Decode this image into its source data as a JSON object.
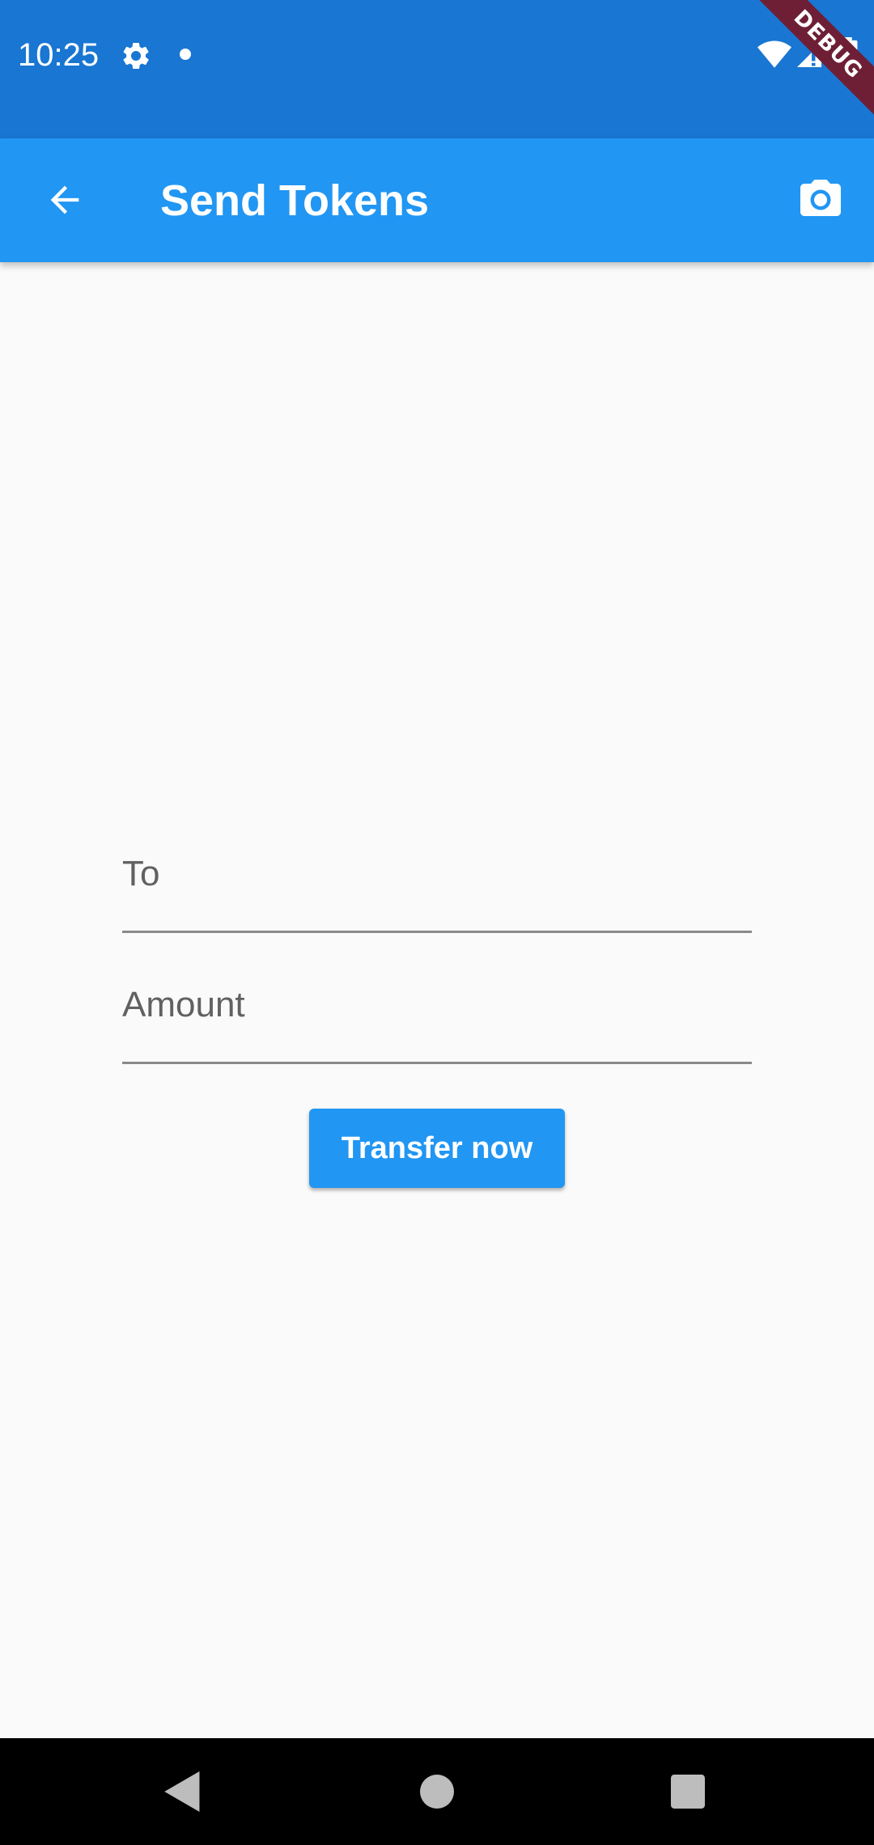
{
  "status_bar": {
    "time": "10:25",
    "icons": [
      "gear-icon",
      "notification-dot-icon",
      "wifi-icon",
      "signal-icon",
      "battery-icon"
    ],
    "color": "#1976d2"
  },
  "debug_banner": {
    "label": "DEBUG",
    "color": "#6e1f36"
  },
  "app_bar": {
    "title": "Send Tokens",
    "back_icon": "arrow-back-icon",
    "action_icon": "camera-icon",
    "color": "#2196f3"
  },
  "form": {
    "to": {
      "label": "To",
      "value": ""
    },
    "amount": {
      "label": "Amount",
      "value": ""
    },
    "submit_label": "Transfer now"
  },
  "nav_bar": {
    "icons": [
      "nav-back-icon",
      "nav-home-icon",
      "nav-recents-icon"
    ]
  }
}
